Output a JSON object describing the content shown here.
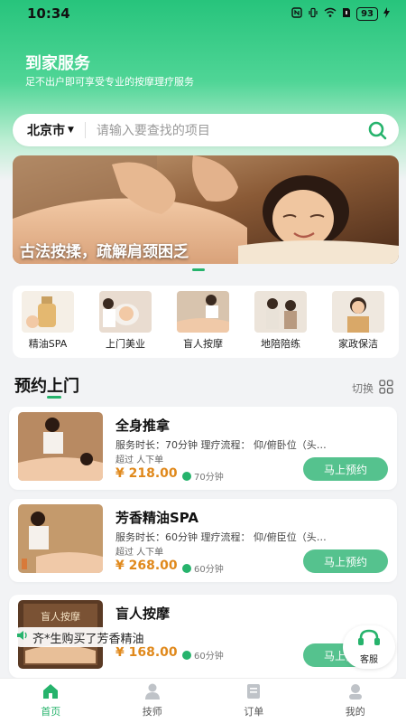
{
  "status_bar": {
    "time": "10:34",
    "battery": "93"
  },
  "header": {
    "title": "到家服务",
    "subtitle": "足不出户即可享受专业的按摩理疗服务"
  },
  "search": {
    "city": "北京市",
    "placeholder": "请输入要查找的项目"
  },
  "banner": {
    "caption": "古法按揉，疏解肩颈困乏"
  },
  "categories": [
    {
      "label": "精油SPA"
    },
    {
      "label": "上门美业"
    },
    {
      "label": "盲人按摩"
    },
    {
      "label": "地陪陪练"
    },
    {
      "label": "家政保洁"
    }
  ],
  "section": {
    "title": "预约上门",
    "switch_label": "切换"
  },
  "services": [
    {
      "name": "全身推拿",
      "meta": "服务时长：70分钟  理疗流程：  仰/俯卧位（头…",
      "orders": "超过 人下单",
      "price": "¥ 218.00",
      "duration": "70分钟",
      "button": "马上预约"
    },
    {
      "name": "芳香精油SPA",
      "meta": "服务时长：60分钟  理疗流程：  仰/俯臣位（头…",
      "orders": "超过 人下单",
      "price": "¥ 268.00",
      "duration": "60分钟",
      "button": "马上预约"
    },
    {
      "name": "盲人按摩",
      "image_text": "盲人按摩",
      "price": "¥ 168.00",
      "duration": "60分钟",
      "button": "马上预约"
    }
  ],
  "ticker": {
    "text": "齐*生购买了芳香精油"
  },
  "support": {
    "label": "客服"
  },
  "tabbar": [
    {
      "label": "首页",
      "active": true
    },
    {
      "label": "技师"
    },
    {
      "label": "订单"
    },
    {
      "label": "我的"
    }
  ],
  "colors": {
    "brand": "#26b36c",
    "price": "#e0891c",
    "button": "#55c28e"
  }
}
